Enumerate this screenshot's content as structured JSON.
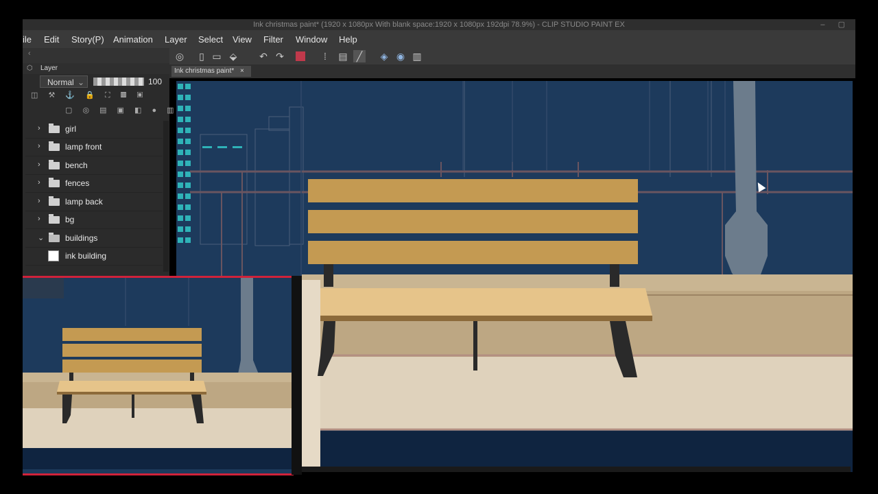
{
  "window": {
    "title": "Ink christmas paint* (1920 x 1080px With blank space:1920 x 1080px 192dpi 78.9%) - CLIP STUDIO PAINT EX"
  },
  "menu": {
    "items": [
      "ile",
      "Edit",
      "Story(P)",
      "Animation",
      "Layer",
      "Select",
      "View",
      "Filter",
      "Window",
      "Help"
    ]
  },
  "document_tab": {
    "label": "Ink christmas paint*",
    "close": "×"
  },
  "layer_panel": {
    "title": "Layer",
    "blend_mode": "Normal",
    "opacity": "100",
    "layers": [
      {
        "name": "girl",
        "type": "folder",
        "expanded": false
      },
      {
        "name": "lamp front",
        "type": "folder",
        "expanded": false
      },
      {
        "name": "bench",
        "type": "folder",
        "expanded": false
      },
      {
        "name": "fences",
        "type": "folder",
        "expanded": false
      },
      {
        "name": "lamp back",
        "type": "folder",
        "expanded": false
      },
      {
        "name": "bg",
        "type": "folder",
        "expanded": false
      },
      {
        "name": "buildings",
        "type": "folder",
        "expanded": true
      },
      {
        "name": "ink building",
        "type": "raster",
        "expanded": false
      }
    ]
  },
  "colors": {
    "sky": "#1d3a5c",
    "bench_wood": "#c49a52",
    "bench_seat": "#e6c48a",
    "bench_legs": "#2a2a2a",
    "lamp": "#6c7c8c",
    "ground_back": "#bda783",
    "ground_front": "#dfd2bc",
    "water": "#0f2440",
    "main_color_swatch": "#c0394b"
  },
  "icons": [
    "layer-icon",
    "undo-icon",
    "redo-icon",
    "pen-icon",
    "color-swatch-icon",
    "folder-icon",
    "chevron-right-icon",
    "chevron-down-icon",
    "lock-icon",
    "cursor-icon"
  ]
}
